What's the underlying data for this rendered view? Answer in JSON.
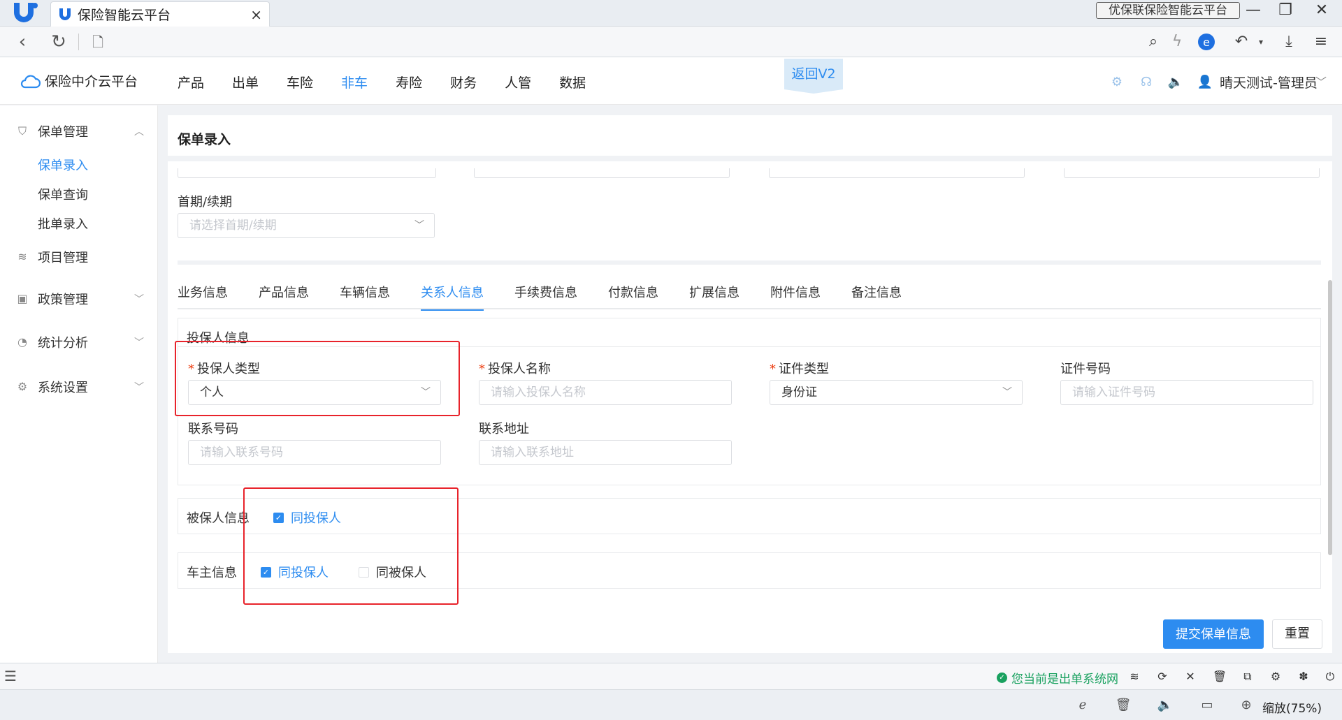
{
  "browser": {
    "tab_title": "保险智能云平台",
    "tab_close": "×",
    "brand_box": "优保联保险智能云平台",
    "minimize": "—",
    "maximize": "❐",
    "close": "✕"
  },
  "header": {
    "brand": "保险中介云平台",
    "nav": [
      "产品",
      "出单",
      "车险",
      "非车",
      "寿险",
      "财务",
      "人管",
      "数据"
    ],
    "active_nav": "非车",
    "v2_badge": "返回V2",
    "user": "晴天测试-管理员"
  },
  "sidebar": {
    "groups": [
      {
        "label": "保单管理",
        "icon": "shield-icon",
        "expanded": true,
        "children": [
          "保单录入",
          "保单查询",
          "批单录入"
        ],
        "active_child": "保单录入"
      },
      {
        "label": "项目管理",
        "icon": "layers-icon"
      },
      {
        "label": "政策管理",
        "icon": "policy-icon"
      },
      {
        "label": "统计分析",
        "icon": "pie-chart-icon"
      },
      {
        "label": "系统设置",
        "icon": "gear-icon"
      }
    ]
  },
  "page": {
    "title": "保单录入",
    "first_renewal_label": "首期/续期",
    "first_renewal_placeholder": "请选择首期/续期"
  },
  "tabs": [
    "业务信息",
    "产品信息",
    "车辆信息",
    "关系人信息",
    "手续费信息",
    "付款信息",
    "扩展信息",
    "附件信息",
    "备注信息"
  ],
  "active_tab": "关系人信息",
  "applicant": {
    "section_title": "投保人信息",
    "type_label": "投保人类型",
    "type_value": "个人",
    "name_label": "投保人名称",
    "name_placeholder": "请输入投保人名称",
    "id_type_label": "证件类型",
    "id_type_value": "身份证",
    "id_no_label": "证件号码",
    "id_no_placeholder": "请输入证件号码",
    "phone_label": "联系号码",
    "phone_placeholder": "请输入联系号码",
    "address_label": "联系地址",
    "address_placeholder": "请输入联系地址",
    "required_mark": "*"
  },
  "insured": {
    "section_title": "被保人信息",
    "same_as_applicant": "同投保人",
    "same_as_applicant_checked": true
  },
  "owner": {
    "section_title": "车主信息",
    "same_as_applicant": "同投保人",
    "same_as_applicant_checked": true,
    "same_as_insured": "同被保人",
    "same_as_insured_checked": false
  },
  "actions": {
    "submit": "提交保单信息",
    "reset": "重置"
  },
  "statusbar": {
    "network_status": "您当前是出单系统网"
  },
  "bottombar": {
    "zoom": "缩放(75%)"
  },
  "colors": {
    "accent": "#2d8cf0",
    "required": "#ed4014",
    "highlight_box": "#e8232b",
    "status_ok": "#19a15f"
  }
}
